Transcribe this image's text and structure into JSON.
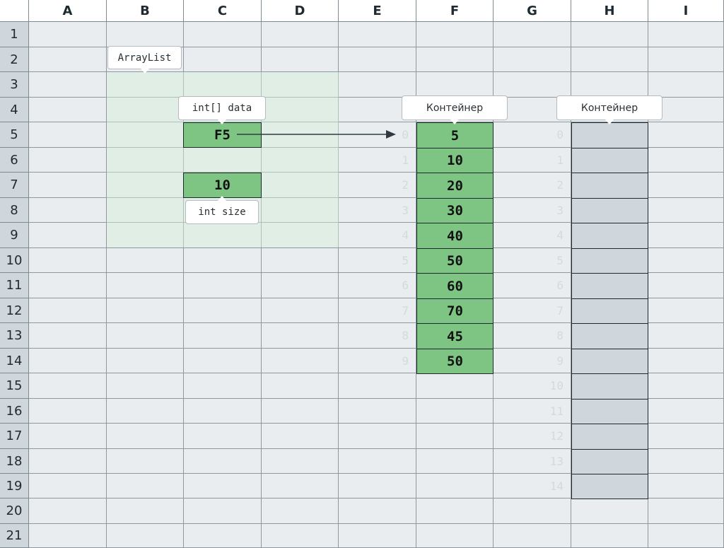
{
  "columns": [
    "A",
    "B",
    "C",
    "D",
    "E",
    "F",
    "G",
    "H",
    "I"
  ],
  "rows": [
    "1",
    "2",
    "3",
    "4",
    "5",
    "6",
    "7",
    "8",
    "9",
    "10",
    "11",
    "12",
    "13",
    "14",
    "15",
    "16",
    "17",
    "18",
    "19",
    "20",
    "21"
  ],
  "labels": {
    "arraylist": "ArrayList",
    "data_field": "int[] data",
    "size_field": "int size",
    "container_left": "Контейнер",
    "container_right": "Контейнер"
  },
  "arraylist": {
    "data_ref": "F5",
    "size": "10"
  },
  "container_left": {
    "indices": [
      "0",
      "1",
      "2",
      "3",
      "4",
      "5",
      "6",
      "7",
      "8",
      "9"
    ],
    "values": [
      "5",
      "10",
      "20",
      "30",
      "40",
      "50",
      "60",
      "70",
      "45",
      "50"
    ]
  },
  "container_right": {
    "indices": [
      "0",
      "1",
      "2",
      "3",
      "4",
      "5",
      "6",
      "7",
      "8",
      "9",
      "10",
      "11",
      "12",
      "13",
      "14"
    ]
  },
  "colors": {
    "filled_cell": "#7ec584",
    "empty_cell": "#cfd6dc",
    "object_region": "#d6f0d6",
    "arrow": "#2f3b42"
  }
}
